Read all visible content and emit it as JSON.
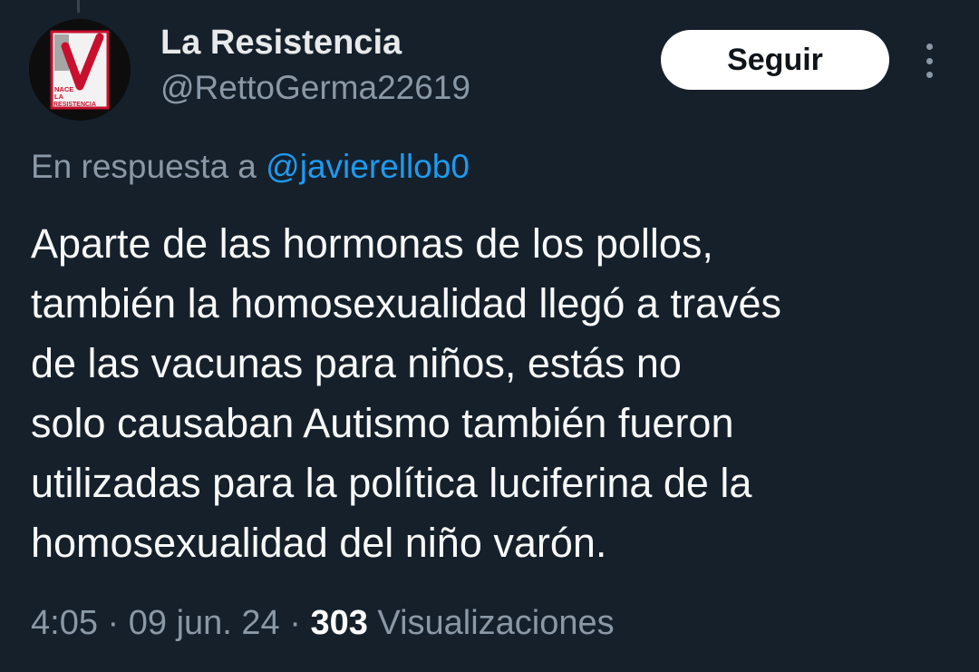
{
  "author": {
    "name": "La Resistencia",
    "handle": "@RettoGerma22619",
    "avatar_text": [
      "NACE",
      "LA",
      "RESISTENCIA"
    ]
  },
  "actions": {
    "follow_label": "Seguir",
    "more_icon": "more-vertical-icon"
  },
  "reply": {
    "prefix": "En respuesta a ",
    "mention": "@javierellob0"
  },
  "tweet": {
    "lines": [
      "Aparte de las hormonas de los pollos,",
      "también la homosexualidad llegó a través",
      "de las vacunas para niños, estás no",
      "solo causaban Autismo también fueron",
      "utilizadas para la política luciferina de la",
      "homosexualidad del niño varón."
    ]
  },
  "meta": {
    "time": "4:05",
    "separator": " · ",
    "date": "09 jun. 24",
    "views_count": "303",
    "views_label": " Visualizaciones"
  },
  "colors": {
    "background": "#15202b",
    "text": "#e7e9ea",
    "secondary": "#8b98a5",
    "link": "#1d9bf0",
    "button_bg": "#ffffff"
  }
}
